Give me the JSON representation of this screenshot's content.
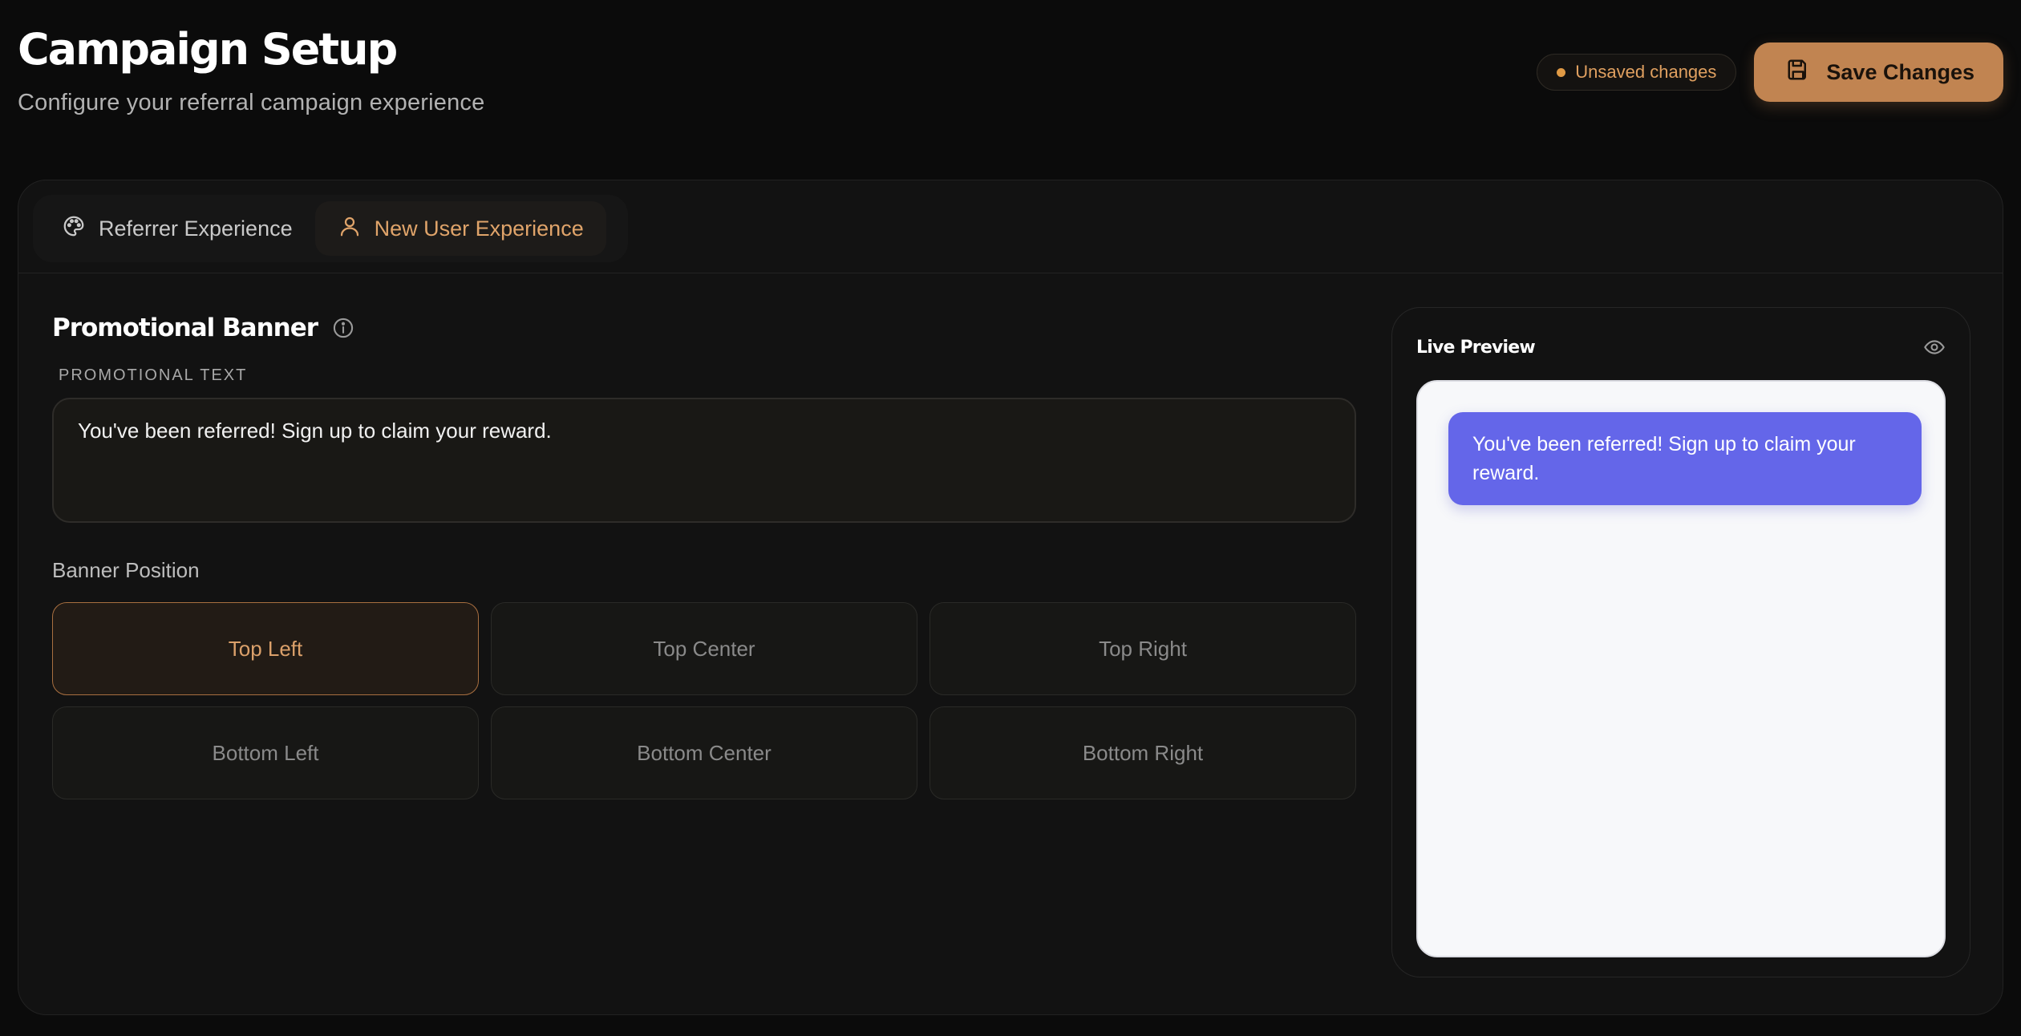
{
  "header": {
    "title": "Campaign Setup",
    "subtitle": "Configure your referral campaign experience",
    "unsaved_label": "Unsaved changes",
    "save_label": "Save Changes"
  },
  "tabs": [
    {
      "label": "Referrer Experience",
      "icon": "palette-icon",
      "active": false
    },
    {
      "label": "New User Experience",
      "icon": "user-icon",
      "active": true
    }
  ],
  "promotional_banner": {
    "title": "Promotional Banner",
    "field_label": "PROMOTIONAL TEXT",
    "text": "You've been referred! Sign up to claim your reward."
  },
  "banner_position": {
    "label": "Banner Position",
    "options": [
      "Top Left",
      "Top Center",
      "Top Right",
      "Bottom Left",
      "Bottom Center",
      "Bottom Right"
    ],
    "selected": "Top Left"
  },
  "preview": {
    "title": "Live Preview",
    "banner_text": "You've been referred! Sign up to claim your reward."
  },
  "colors": {
    "accent": "#c18451",
    "banner": "#6466e9",
    "background": "#0b0b0b"
  }
}
